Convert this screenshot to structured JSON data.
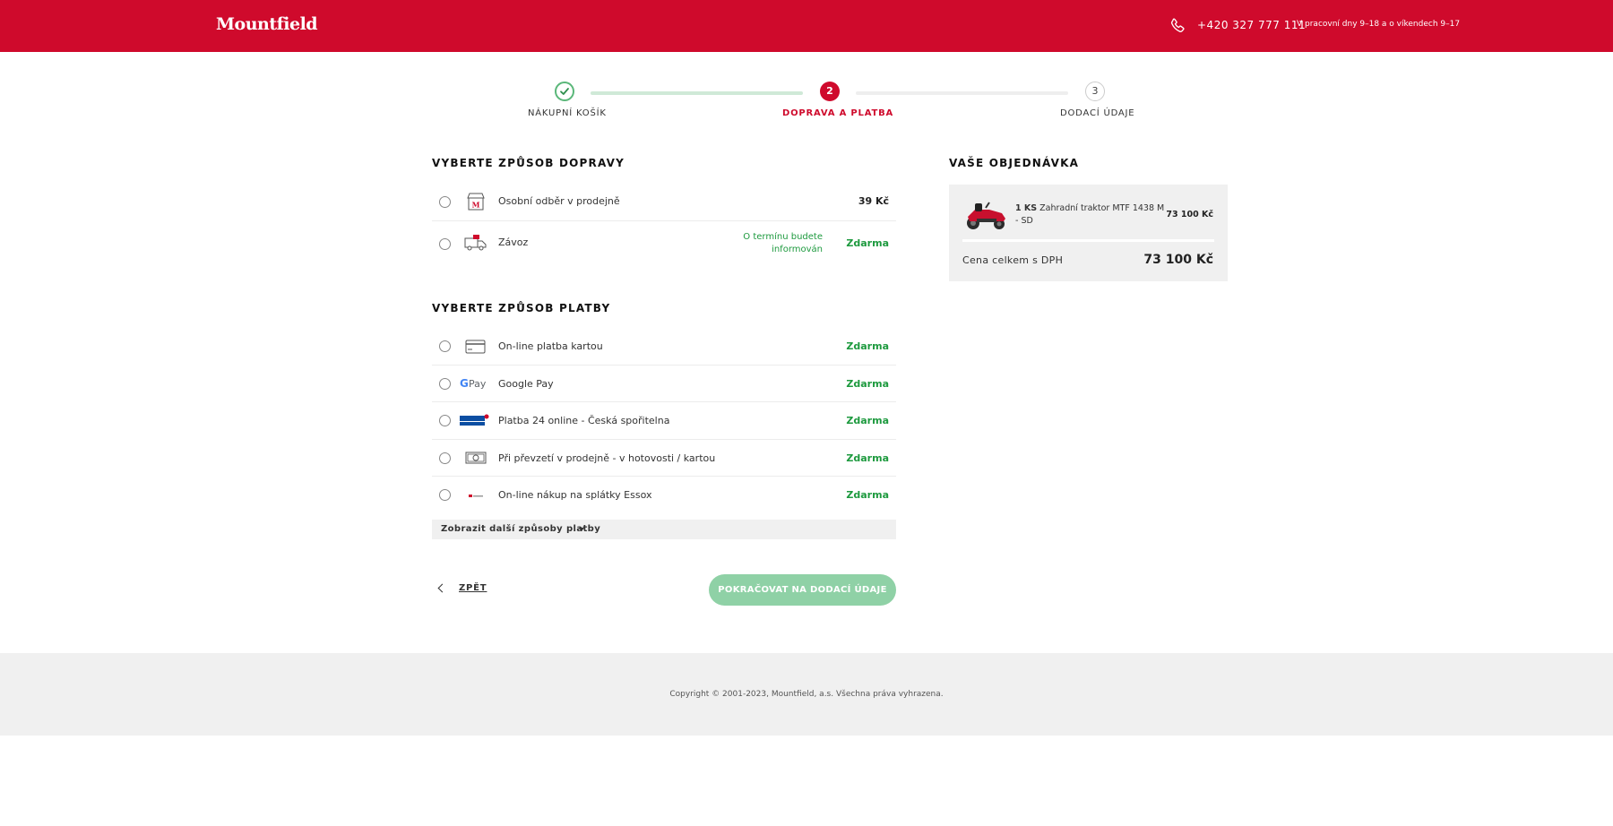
{
  "header": {
    "logo": "Mountfield",
    "phone": "+420 327 777 111",
    "hours": "V pracovní dny 9–18 a o víkendech 9–17"
  },
  "stepper": {
    "steps": [
      {
        "number": "1",
        "label": "NÁKUPNÍ KOŠÍK",
        "state": "done"
      },
      {
        "number": "2",
        "label": "DOPRAVA A PLATBA",
        "state": "active"
      },
      {
        "number": "3",
        "label": "DODACÍ ÚDAJE",
        "state": "pending"
      }
    ]
  },
  "shipping": {
    "title": "VYBERTE ZPŮSOB DOPRAVY",
    "options": [
      {
        "label": "Osobní odběr v prodejně",
        "price": "39 Kč",
        "icon": "store-icon"
      },
      {
        "label": "Závoz",
        "note_line1": "O termínu budete",
        "note_line2": "informován",
        "price": "Zdarma",
        "icon": "delivery-truck-icon"
      }
    ]
  },
  "payment": {
    "title": "VYBERTE ZPŮSOB PLATBY",
    "options": [
      {
        "label": "On-line platba kartou",
        "price": "Zdarma",
        "icon": "credit-card-icon"
      },
      {
        "label": "Google Pay",
        "price": "Zdarma",
        "icon": "google-pay-icon"
      },
      {
        "label": "Platba 24 online - Česká spořitelna",
        "price": "Zdarma",
        "icon": "ceska-sporitelna-icon"
      },
      {
        "label": "Při převzetí v prodejně - v hotovosti / kartou",
        "price": "Zdarma",
        "icon": "cash-icon"
      },
      {
        "label": "On-line nákup na splátky Essox",
        "price": "Zdarma",
        "icon": "essox-icon"
      }
    ],
    "more_label": "Zobrazit další způsoby platby"
  },
  "nav": {
    "back_label": "ZPĚT",
    "continue_label": "POKRAČOVAT NA DODACÍ ÚDAJE"
  },
  "order": {
    "title": "VAŠE OBJEDNÁVKA",
    "item": {
      "qty": "1 KS",
      "name": "Zahradní traktor MTF 1438 M - SD",
      "price": "73 100 Kč"
    },
    "total_label": "Cena celkem s DPH",
    "total_value": "73 100 Kč"
  },
  "footer": {
    "copyright": "Copyright © 2001-2023, Mountfield, a.s. Všechna práva vyhrazena."
  },
  "colors": {
    "brand_red": "#cf0a2c",
    "free_green": "#1e9a3f",
    "button_green": "#8fd1a6"
  }
}
